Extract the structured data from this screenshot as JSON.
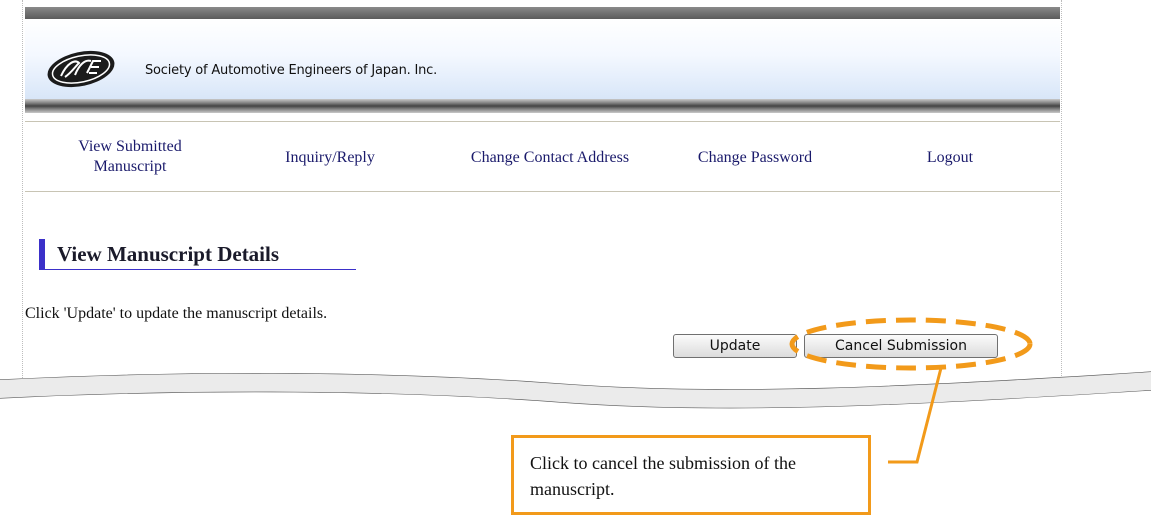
{
  "header": {
    "org_name": "Society of Automotive Engineers of Japan. Inc."
  },
  "nav": {
    "items": [
      {
        "label_line1": "View Submitted",
        "label_line2": "Manuscript"
      },
      {
        "label": "Inquiry/Reply"
      },
      {
        "label": "Change Contact Address"
      },
      {
        "label": "Change Password"
      },
      {
        "label": "Logout"
      }
    ]
  },
  "main": {
    "section_title": "View Manuscript Details",
    "instruction": "Click 'Update' to update the manuscript details.",
    "update_label": "Update",
    "cancel_label": "Cancel Submission"
  },
  "callout": {
    "text": "Click to cancel the submission of the manuscript."
  },
  "colors": {
    "accent": "#3b30c9",
    "callout": "#f29a1a",
    "nav_text": "#1a1a6b"
  },
  "icons": {
    "logo": "jsae-logo"
  }
}
